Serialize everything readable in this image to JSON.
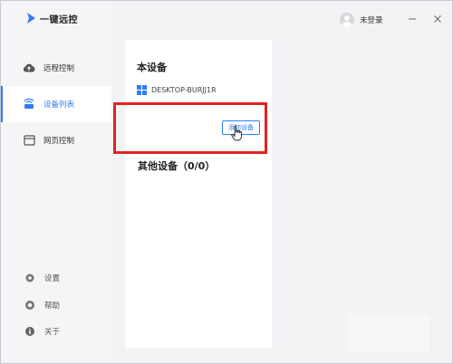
{
  "app": {
    "brand": "一键远控",
    "accent_color": "#2f7cf6",
    "highlight_color": "#e32222"
  },
  "sidebar": {
    "items": [
      {
        "label": "远程控制",
        "icon": "cloud-icon",
        "active": false
      },
      {
        "label": "设备列表",
        "icon": "device-list-icon",
        "active": true
      },
      {
        "label": "网页控制",
        "icon": "webpage-icon",
        "active": false
      }
    ],
    "bottom": [
      {
        "label": "设置",
        "icon": "gear-icon"
      },
      {
        "label": "帮助",
        "icon": "help-icon"
      },
      {
        "label": "关于",
        "icon": "info-icon"
      }
    ]
  },
  "titlebar": {
    "user_label": "未登录",
    "minimize_icon": "minimize-icon",
    "close_icon": "close-icon"
  },
  "content": {
    "local_title": "本设备",
    "local_device_name": "DESKTOP-BURJJ1R",
    "other_title": "其他设备（0/0）",
    "add_button": "添加设备"
  }
}
